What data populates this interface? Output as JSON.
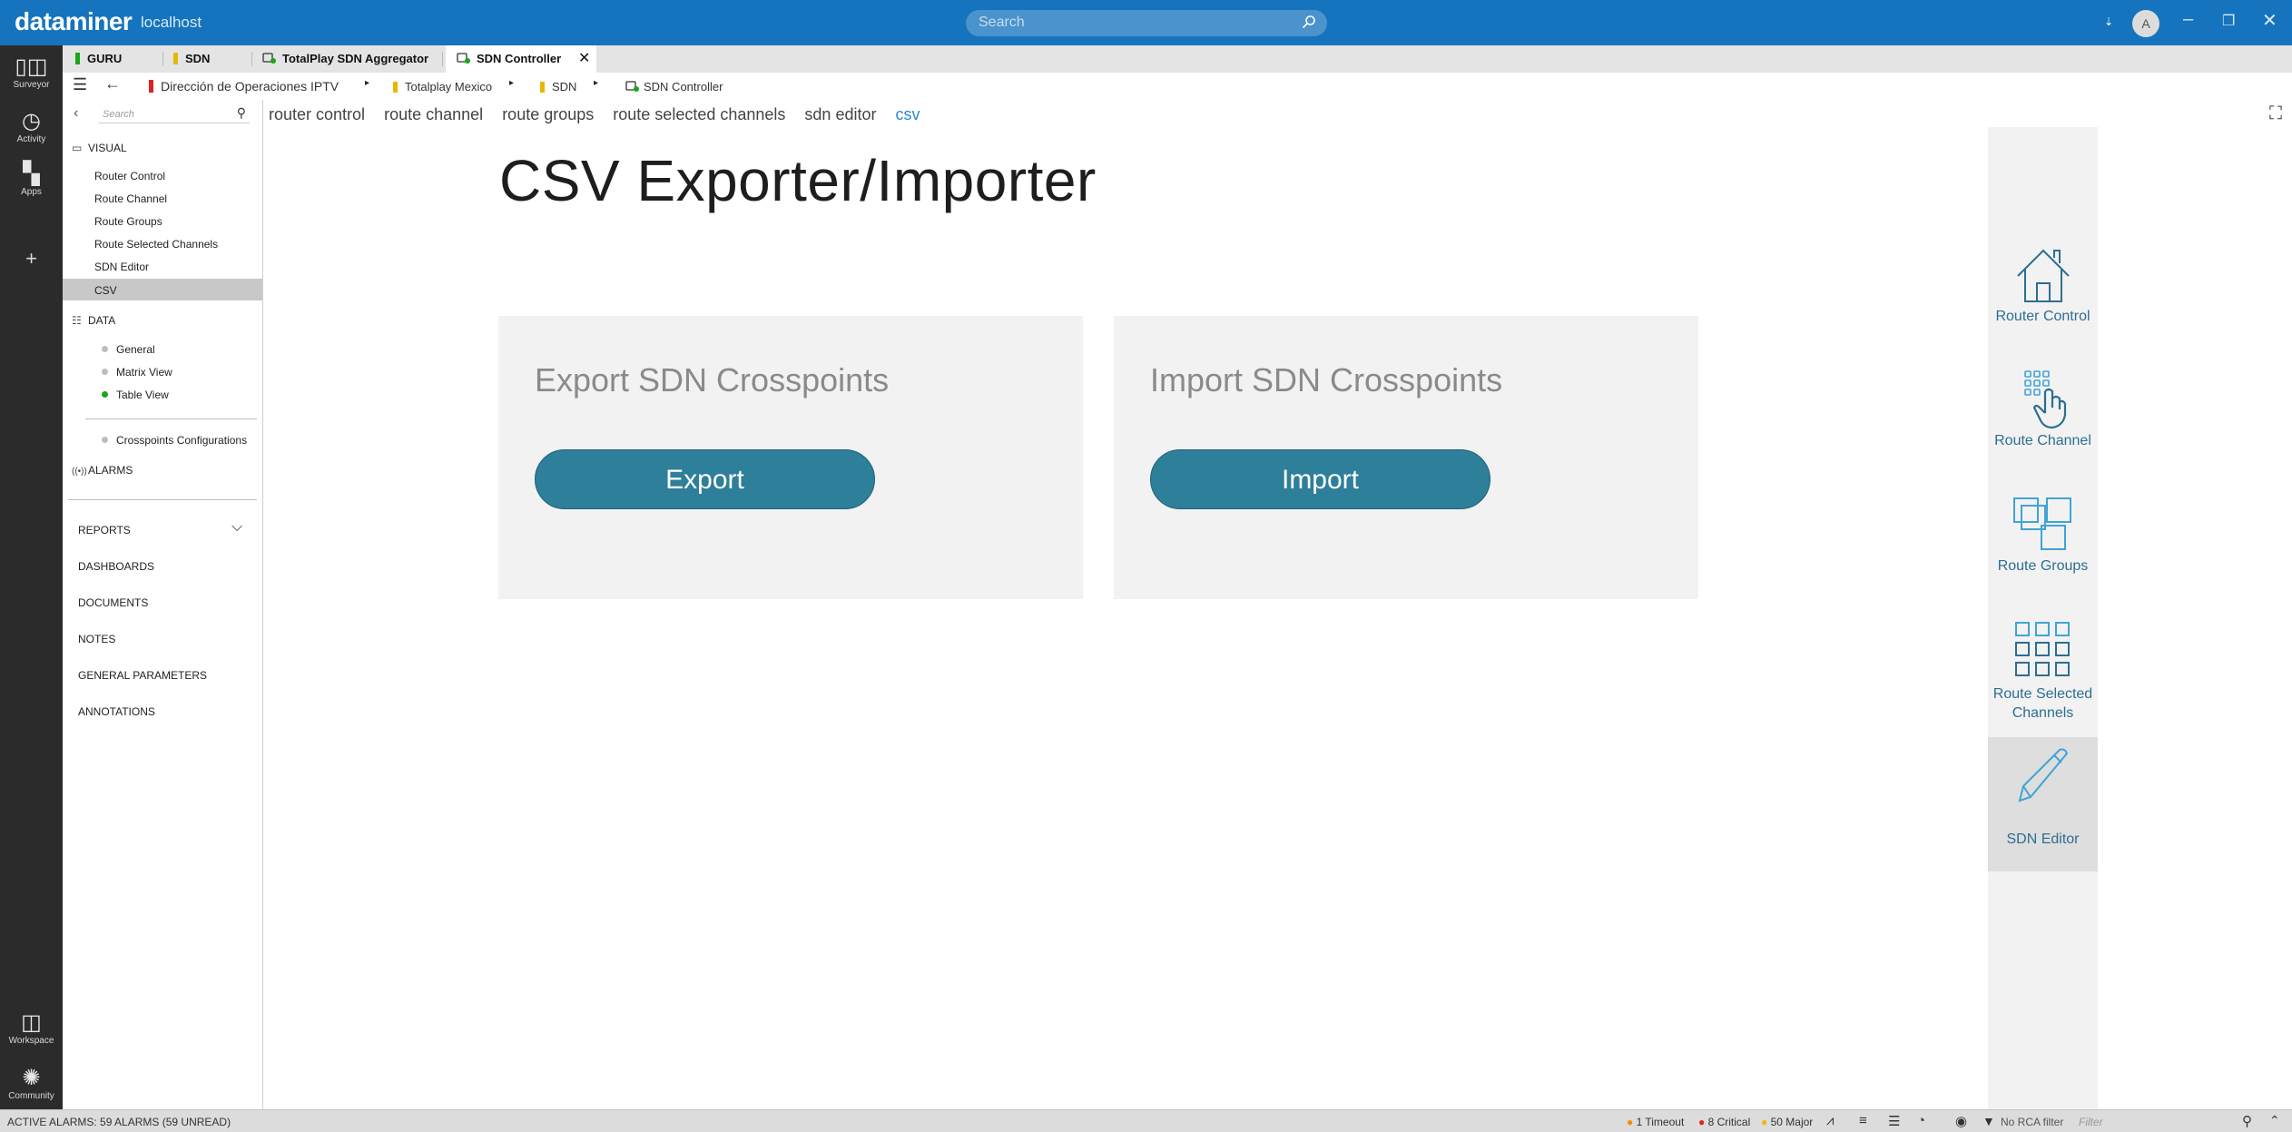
{
  "app": {
    "brand": "dataminer",
    "host": "localhost",
    "search_placeholder": "Search",
    "user_initial": "A"
  },
  "tabs": [
    {
      "label": "GURU",
      "marker": "#19a619"
    },
    {
      "label": "SDN",
      "marker": "#e6b800"
    },
    {
      "label": "TotalPlay SDN Aggregator",
      "icon": "element-icon"
    },
    {
      "label": "SDN Controller",
      "icon": "element-icon",
      "active": true
    }
  ],
  "breadcrumb": [
    "Dirección de Operaciones IPTV",
    "Totalplay Mexico",
    "SDN",
    "SDN Controller"
  ],
  "leftnav": [
    {
      "label": "Surveyor"
    },
    {
      "label": "Activity"
    },
    {
      "label": "Apps"
    },
    {
      "label": "Workspace"
    },
    {
      "label": "Community"
    }
  ],
  "sidebar": {
    "search_placeholder": "Search",
    "visual_label": "VISUAL",
    "visual_items": [
      "Router Control",
      "Route Channel",
      "Route Groups",
      "Route Selected Channels",
      "SDN Editor",
      "CSV"
    ],
    "data_label": "DATA",
    "data_items": [
      {
        "label": "General",
        "dot": "#bdbdbd"
      },
      {
        "label": "Matrix View",
        "dot": "#bdbdbd"
      },
      {
        "label": "Table View",
        "dot": "#19a619"
      }
    ],
    "config_item": "Crosspoints Configurations",
    "alarms_label": "ALARMS",
    "categories": [
      "REPORTS",
      "DASHBOARDS",
      "DOCUMENTS",
      "NOTES",
      "GENERAL PARAMETERS",
      "ANNOTATIONS"
    ]
  },
  "viewnav": [
    "router control",
    "route channel",
    "route groups",
    "route selected channels",
    "sdn editor",
    "csv"
  ],
  "page": {
    "title": "CSV Exporter/Importer"
  },
  "cards": [
    {
      "title": "Export SDN Crosspoints",
      "button": "Export"
    },
    {
      "title": "Import SDN Crosspoints",
      "button": "Import"
    }
  ],
  "rightpanel": [
    {
      "label": "Router Control",
      "icon": "home-icon"
    },
    {
      "label": "Route Channel",
      "icon": "hand-keypad-icon"
    },
    {
      "label": "Route Groups",
      "icon": "stacked-squares-icon"
    },
    {
      "label": "Route Selected Channels",
      "icon": "grid-icon"
    },
    {
      "label": "SDN Editor",
      "icon": "pencil-icon"
    }
  ],
  "status": {
    "alarms": "ACTIVE ALARMS: 59 ALARMS (59 UNREAD)",
    "timeout": "1 Timeout",
    "critical": "8 Critical",
    "major": "50 Major",
    "rca": "No RCA filter",
    "filter_placeholder": "Filter",
    "colors": {
      "timeout": "#f28c00",
      "critical": "#e02020",
      "major": "#f2b600"
    }
  }
}
